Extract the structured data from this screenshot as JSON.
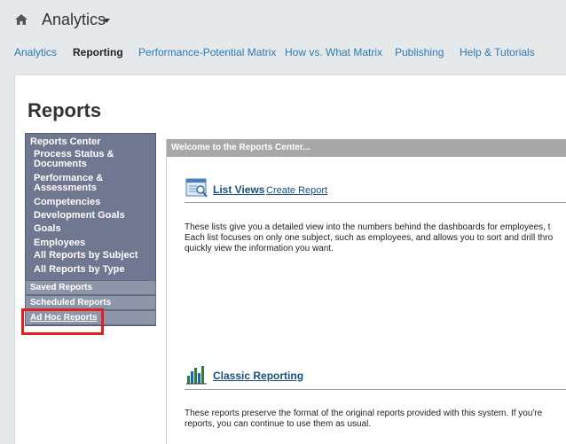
{
  "header": {
    "app_title": "Analytics"
  },
  "nav": {
    "tabs": [
      "Analytics",
      "Reporting",
      "Performance-Potential Matrix",
      "How vs. What Matrix",
      "Publishing",
      "Help & Tutorials"
    ]
  },
  "page": {
    "title": "Reports"
  },
  "sidebar": {
    "heading": "Reports Center",
    "items": [
      "Process Status & Documents",
      "Performance & Assessments",
      "Competencies",
      "Development Goals",
      "Goals",
      "Employees",
      "All Reports by Subject",
      "All Reports by Type"
    ],
    "sections": [
      "Saved Reports",
      "Scheduled Reports",
      "Ad Hoc Reports"
    ]
  },
  "panel": {
    "header": "Welcome to the Reports Center...",
    "list_views": {
      "title": "List Views",
      "link": "Create Report",
      "lines": [
        "These lists give you a detailed view into the numbers behind the dashboards for employees, t",
        "Each list focuses on only one subject, such as employees, and allows you to sort and drill thro",
        "quickly view the information you want."
      ]
    },
    "classic": {
      "title": "Classic Reporting",
      "lines": [
        "These reports preserve the format of the original reports provided with this system. If you're",
        "reports, you can continue to use them as usual."
      ]
    }
  },
  "colors": {
    "nav_link": "#2a7ab8",
    "sidebar_bg": "#6f7890",
    "highlight": "#e02020"
  }
}
